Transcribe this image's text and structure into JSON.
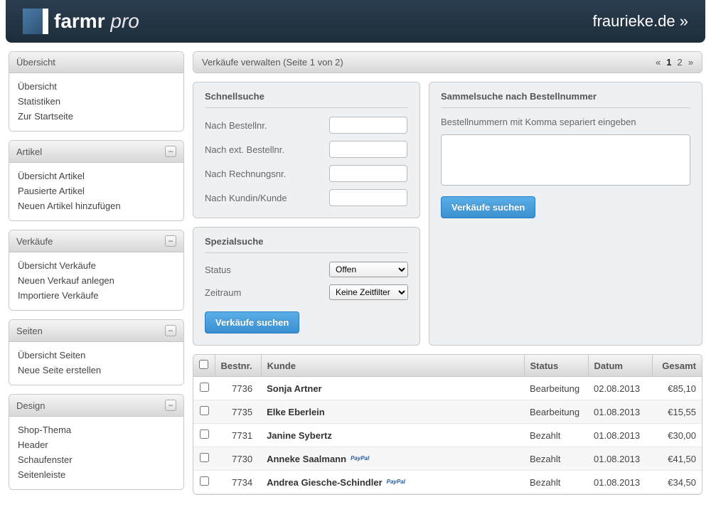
{
  "header": {
    "brand_main": "farmr",
    "brand_sub": "pro",
    "right_text": "fraurieke.de »"
  },
  "sidebar": {
    "sections": [
      {
        "title": "Übersicht",
        "collapsible": false,
        "items": [
          "Übersicht",
          "Statistiken",
          "Zur Startseite"
        ]
      },
      {
        "title": "Artikel",
        "collapsible": true,
        "items": [
          "Übersicht Artikel",
          "Pausierte Artikel",
          "Neuen Artikel hinzufügen"
        ]
      },
      {
        "title": "Verkäufe",
        "collapsible": true,
        "items": [
          "Übersicht Verkäufe",
          "Neuen Verkauf anlegen",
          "Importiere Verkäufe"
        ]
      },
      {
        "title": "Seiten",
        "collapsible": true,
        "items": [
          "Übersicht Seiten",
          "Neue Seite erstellen"
        ]
      },
      {
        "title": "Design",
        "collapsible": true,
        "items": [
          "Shop-Thema",
          "Header",
          "Schaufenster",
          "Seitenleiste"
        ]
      }
    ]
  },
  "content": {
    "title": "Verkäufe verwalten (Seite 1 von 2)",
    "pagination": {
      "prev": "«",
      "pages": [
        "1",
        "2"
      ],
      "current": "1",
      "next": "»"
    }
  },
  "quicksearch": {
    "title": "Schnellsuche",
    "fields": {
      "bestellnr": "Nach Bestellnr.",
      "ext_bestellnr": "Nach ext. Bestellnr.",
      "rechnungsnr": "Nach Rechnungsnr.",
      "kunde": "Nach Kundin/Kunde"
    }
  },
  "specialsearch": {
    "title": "Spezialsuche",
    "status_label": "Status",
    "status_value": "Offen",
    "zeitraum_label": "Zeitraum",
    "zeitraum_value": "Keine Zeitfilter",
    "button": "Verkäufe suchen"
  },
  "batchsearch": {
    "title": "Sammelsuche nach Bestellnummer",
    "hint": "Bestellnummern mit Komma separiert eingeben",
    "button": "Verkäufe suchen"
  },
  "table": {
    "headers": {
      "bestnr": "Bestnr.",
      "kunde": "Kunde",
      "status": "Status",
      "datum": "Datum",
      "gesamt": "Gesamt"
    },
    "rows": [
      {
        "bestnr": "7736",
        "kunde": "Sonja Artner",
        "paypal": false,
        "status": "Bearbeitung",
        "datum": "02.08.2013",
        "gesamt": "€85,10"
      },
      {
        "bestnr": "7735",
        "kunde": "Elke Eberlein",
        "paypal": false,
        "status": "Bearbeitung",
        "datum": "01.08.2013",
        "gesamt": "€15,55"
      },
      {
        "bestnr": "7731",
        "kunde": "Janine Sybertz",
        "paypal": false,
        "status": "Bezahlt",
        "datum": "01.08.2013",
        "gesamt": "€30,00"
      },
      {
        "bestnr": "7730",
        "kunde": "Anneke Saalmann",
        "paypal": true,
        "status": "Bezahlt",
        "datum": "01.08.2013",
        "gesamt": "€41,50"
      },
      {
        "bestnr": "7734",
        "kunde": "Andrea Giesche-Schindler",
        "paypal": true,
        "status": "Bezahlt",
        "datum": "01.08.2013",
        "gesamt": "€34,50"
      }
    ]
  }
}
